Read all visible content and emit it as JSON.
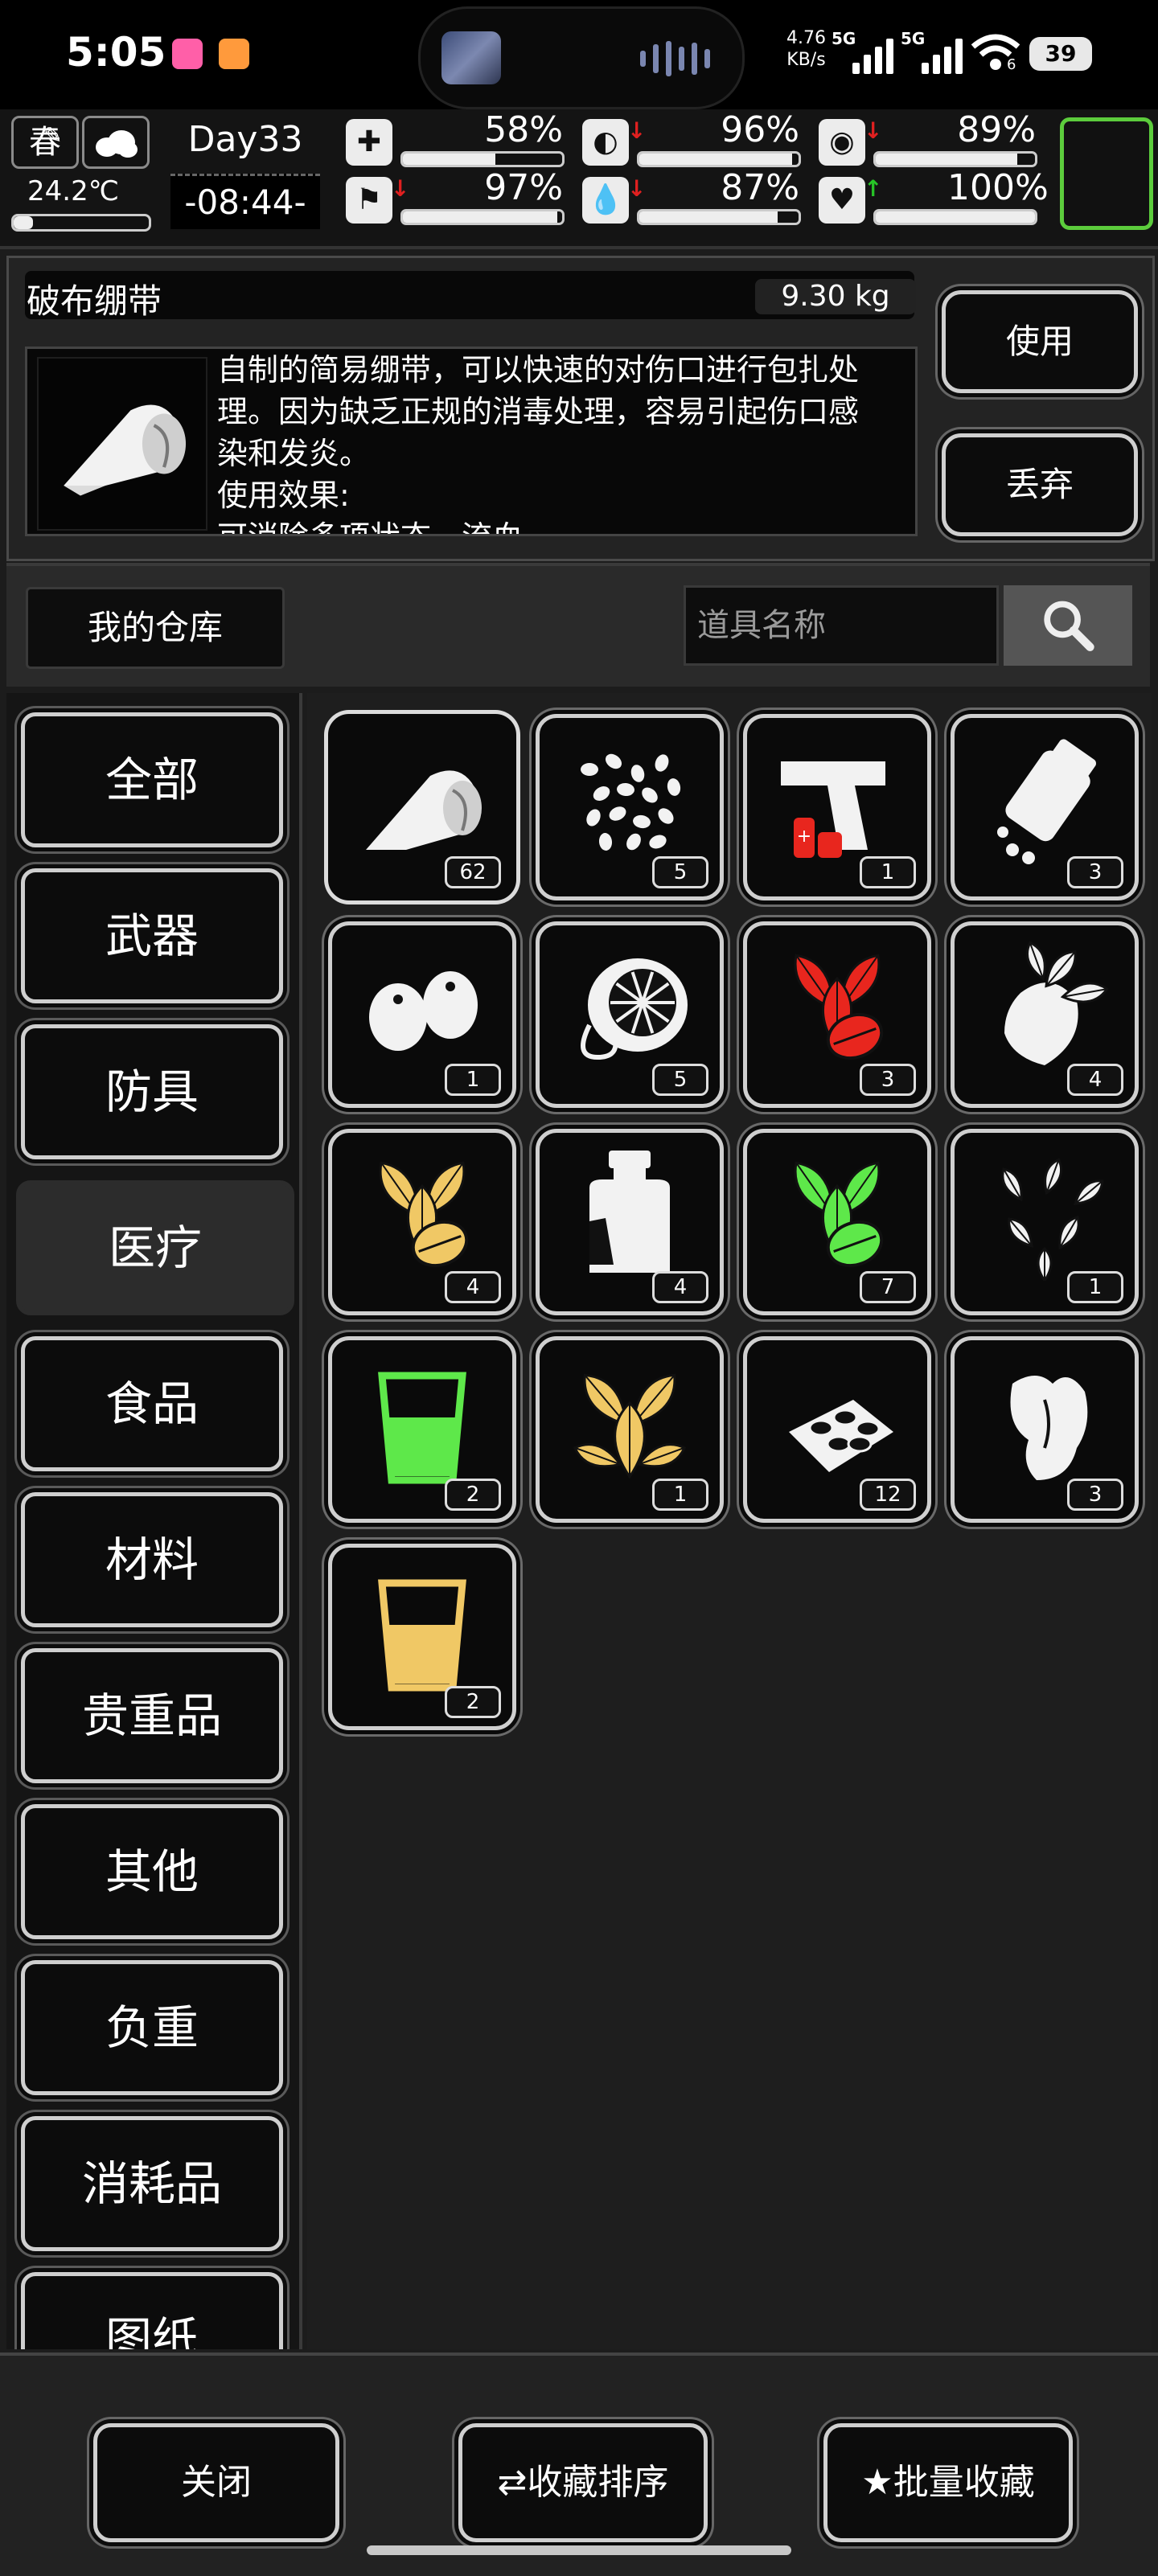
{
  "status_bar": {
    "time": "5:05",
    "net_speed_value": "4.76",
    "net_speed_unit": "KB/s",
    "sim1_label": "5G",
    "sim2_label": "5G",
    "wifi_label": "6",
    "battery": "39"
  },
  "hud": {
    "season": "春",
    "temperature": "24.2℃",
    "day": "Day33",
    "time": "-08:44-",
    "stats": [
      {
        "name": "health-icon",
        "glyph": "✚",
        "pct_text": "58%",
        "value": 0.58,
        "trend": ""
      },
      {
        "name": "stomach-icon",
        "glyph": "◐",
        "pct_text": "96%",
        "value": 0.96,
        "trend": "down"
      },
      {
        "name": "pill-icon",
        "glyph": "◉",
        "pct_text": "89%",
        "value": 0.89,
        "trend": "down"
      },
      {
        "name": "stamina-icon",
        "glyph": "⚑",
        "pct_text": "97%",
        "value": 0.97,
        "trend": "down"
      },
      {
        "name": "water-icon",
        "glyph": "💧",
        "pct_text": "87%",
        "value": 0.87,
        "trend": "down"
      },
      {
        "name": "heart-icon",
        "glyph": "♥",
        "pct_text": "100%",
        "value": 1.0,
        "trend": "up"
      }
    ],
    "colors": {
      "down_arrow": "#e02020",
      "up_arrow": "#27c427",
      "portrait_border": "#5ccc3c"
    }
  },
  "detail": {
    "item_name": "破布绷带",
    "weight": "9.30 kg",
    "description_lines": [
      "自制的简易绷带，可以快速的对伤口进行包扎处",
      "理。因为缺乏正规的消毒处理，容易引起伤口感",
      "染和发炎。",
      "使用效果:",
      "可消除多项状态，流血"
    ],
    "use_label": "使用",
    "drop_label": "丢弃"
  },
  "warehouse": {
    "label": "我的仓库",
    "search_placeholder": "道具名称"
  },
  "categories": [
    "全部",
    "武器",
    "防具",
    "医疗",
    "食品",
    "材料",
    "贵重品",
    "其他",
    "负重",
    "消耗品",
    "图纸"
  ],
  "active_category": "医疗",
  "items": [
    {
      "name": "bandage-icon",
      "count": "62",
      "selected": true
    },
    {
      "name": "seeds-icon",
      "count": "5"
    },
    {
      "name": "flare-gun-icon",
      "count": "1"
    },
    {
      "name": "pill-bottle-icon",
      "count": "3"
    },
    {
      "name": "nuts-icon",
      "count": "1"
    },
    {
      "name": "lemon-slice-icon",
      "count": "5"
    },
    {
      "name": "red-herb-icon",
      "count": "3"
    },
    {
      "name": "ginseng-icon",
      "count": "4"
    },
    {
      "name": "yellow-herb-icon",
      "count": "4"
    },
    {
      "name": "medicine-jar-icon",
      "count": "4"
    },
    {
      "name": "green-herb-icon",
      "count": "7"
    },
    {
      "name": "herb-leaves-icon",
      "count": "1"
    },
    {
      "name": "green-drink-icon",
      "count": "2"
    },
    {
      "name": "yellow-leaves-icon",
      "count": "1"
    },
    {
      "name": "pill-blister-icon",
      "count": "12"
    },
    {
      "name": "ginger-root-icon",
      "count": "3"
    },
    {
      "name": "yellow-drink-icon",
      "count": "2"
    }
  ],
  "colors": {
    "herb_red": "#e8261e",
    "herb_yellow": "#f0c865",
    "herb_green": "#5ee84a"
  },
  "bottom": {
    "close_label": "关闭",
    "sort_label": "收藏排序",
    "batch_label": "批量收藏"
  }
}
